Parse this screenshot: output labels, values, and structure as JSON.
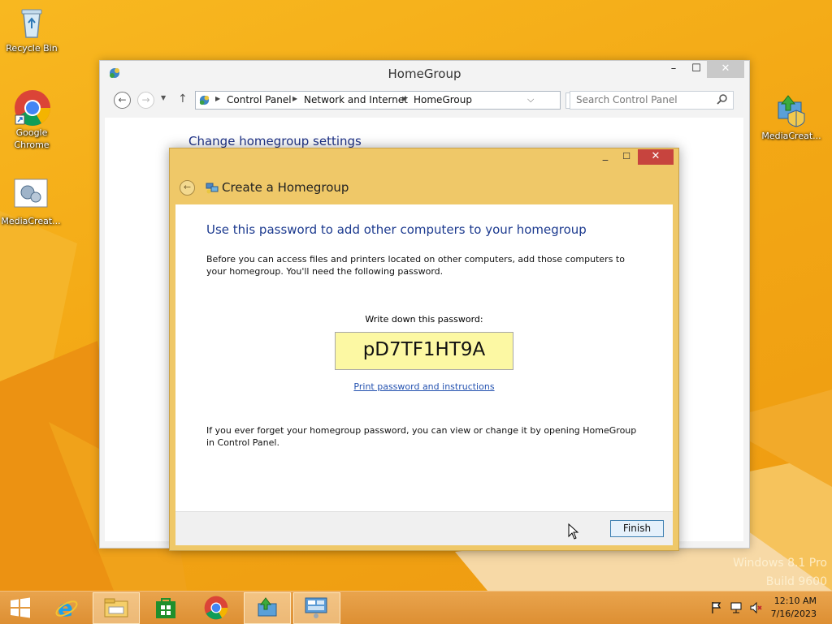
{
  "desktop": {
    "icons": [
      {
        "label": "Recycle Bin"
      },
      {
        "label": "Google Chrome"
      },
      {
        "label": "MediaCreat..."
      },
      {
        "label": "MediaCreat..."
      }
    ],
    "watermark": {
      "line1": "Windows 8.1 Pro",
      "line2": "Build 9600"
    }
  },
  "homegroup_window": {
    "title": "HomeGroup",
    "breadcrumbs": [
      "Control Panel",
      "Network and Internet",
      "HomeGroup"
    ],
    "search_placeholder": "Search Control Panel",
    "heading": "Change homegroup settings"
  },
  "dialog": {
    "title": "Create a Homegroup",
    "heading": "Use this password to add other computers to your homegroup",
    "intro": "Before you can access files and printers located on other computers, add those computers to your homegroup. You'll need the following password.",
    "password_label": "Write down this password:",
    "password": "pD7TF1HT9A",
    "print_link": "Print password and instructions",
    "footer_note": "If you ever forget your homegroup password, you can view or change it by opening HomeGroup in Control Panel.",
    "finish_label": "Finish"
  },
  "taskbar": {
    "time": "12:10 AM",
    "date": "7/16/2023",
    "pinned": [
      "start-icon",
      "internet-explorer-icon",
      "file-explorer-icon",
      "store-icon",
      "chrome-icon",
      "media-creation-tool-icon",
      "control-panel-icon"
    ]
  },
  "colors": {
    "accent": "#f3a815",
    "dialog_frame": "#efc868",
    "link": "#2452b0",
    "heading": "#1c3a8f",
    "password_bg": "#fcf8a3"
  }
}
